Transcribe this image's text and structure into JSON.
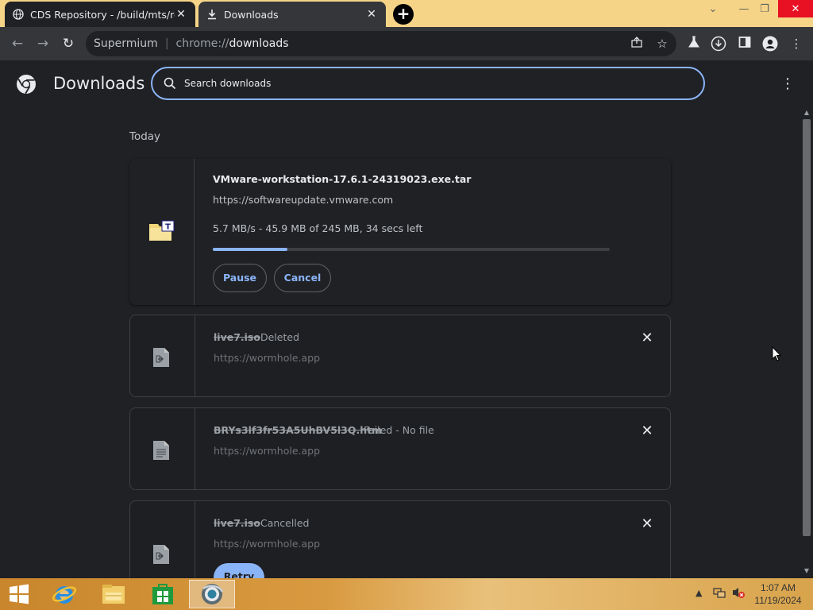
{
  "tabs": [
    {
      "title": "CDS Repository - /build/mts/release/"
    },
    {
      "title": "Downloads"
    }
  ],
  "omnibox": {
    "site": "Supermium",
    "scheme": "chrome://",
    "host": "downloads"
  },
  "header": {
    "title": "Downloads",
    "search_placeholder": "Search downloads"
  },
  "section_date": "Today",
  "downloads": [
    {
      "filename": "VMware-workstation-17.6.1-24319023.exe.tar",
      "url": "https://softwareupdate.vmware.com",
      "progress_text": "5.7 MB/s - 45.9 MB of 245 MB, 34 secs left",
      "progress_fraction": 0.187,
      "buttons": [
        "Pause",
        "Cancel"
      ]
    },
    {
      "filename": "live7.iso",
      "status": "Deleted",
      "url": "https://wormhole.app"
    },
    {
      "filename": "BRYs3lf3fr53A5UhBV5l3Q.htm",
      "status": "Failed - No file",
      "url": "https://wormhole.app"
    },
    {
      "filename": "live7.iso",
      "status": "Cancelled",
      "url": "https://wormhole.app",
      "button": "Retry"
    }
  ],
  "taskbar": {
    "time": "1:07 AM",
    "date": "11/19/2024"
  },
  "colors": {
    "accent": "#8ab4f8",
    "titlebar": "#f5d487",
    "background": "#202124"
  }
}
